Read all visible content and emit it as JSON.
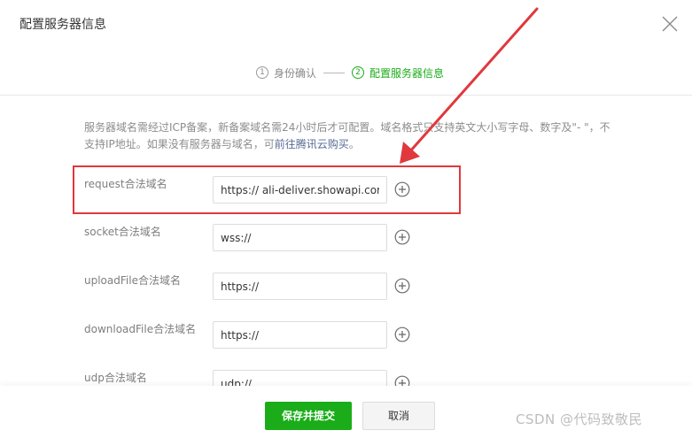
{
  "dialog": {
    "title": "配置服务器信息"
  },
  "steps": [
    {
      "num": "1",
      "label": "身份确认",
      "active": false
    },
    {
      "num": "2",
      "label": "配置服务器信息",
      "active": true
    }
  ],
  "notice": {
    "text_before_link": "服务器域名需经过ICP备案，新备案域名需24小时后才可配置。域名格式只支持英文大小写字母、数字及\"- \"，不支持IP地址。如果没有服务器与域名，可",
    "link_text": "前往腾讯云购买",
    "text_after_link": "。"
  },
  "form": {
    "rows": [
      {
        "label": "request合法域名",
        "value": "https:// ali-deliver.showapi.com"
      },
      {
        "label": "socket合法域名",
        "value": "wss://"
      },
      {
        "label": "uploadFile合法域名",
        "value": "https://"
      },
      {
        "label": "downloadFile合法域名",
        "value": "https://"
      },
      {
        "label": "udp合法域名",
        "value": "udp://"
      }
    ]
  },
  "buttons": {
    "submit": "保存并提交",
    "cancel": "取消"
  },
  "watermark": "CSDN @代码致敬民",
  "colors": {
    "accent": "#1aad19",
    "annotation": "#e0383c",
    "link": "#576b95"
  },
  "icons": {
    "close": "close-icon",
    "add": "plus-circle-icon"
  }
}
